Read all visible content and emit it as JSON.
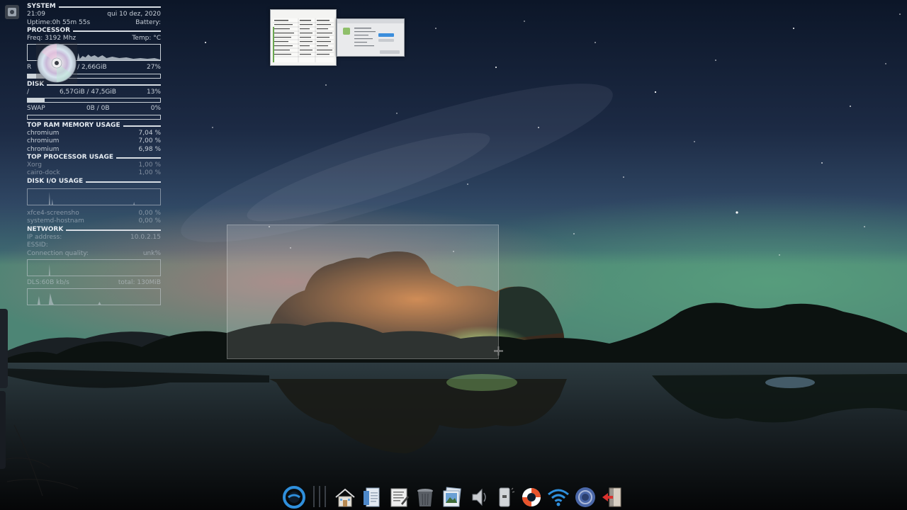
{
  "conky": {
    "system": {
      "header": "SYSTEM",
      "time": "21:09",
      "date": "qui 10 dez, 2020",
      "uptime": "Uptime:0h 55m 55s",
      "battery": "Battery:"
    },
    "processor": {
      "header": "PROCESSOR",
      "freq": "Freq: 3192 Mhz",
      "temp": "Temp: °C"
    },
    "memory": {
      "label": "R",
      "usage": "3 / 2,66GiB",
      "percent": "27%",
      "fill": 0.27
    },
    "disk": {
      "header": "DISK",
      "mount": "/",
      "usage": "6,57GiB / 47,5GiB",
      "percent": "13%",
      "fill": 0.13
    },
    "swap": {
      "label": "SWAP",
      "usage": "0B  /  0B",
      "percent": "0%",
      "fill": 0.0
    },
    "top_ram": {
      "header": "TOP RAM MEMORY USAGE",
      "items": [
        {
          "name": "chromium",
          "value": "7,04 %"
        },
        {
          "name": "chromium",
          "value": "7,00 %"
        },
        {
          "name": "chromium",
          "value": "6,98 %"
        }
      ]
    },
    "top_cpu": {
      "header": "TOP PROCESSOR USAGE",
      "items": [
        {
          "name": "Xorg",
          "value": "1,00 %"
        },
        {
          "name": "cairo-dock",
          "value": "1,00 %"
        }
      ]
    },
    "disk_io": {
      "header": "DISK I/O USAGE",
      "items": [
        {
          "name": "xfce4-screensho",
          "value": "0,00 %"
        },
        {
          "name": "systemd-hostnam",
          "value": "0,00 %"
        }
      ]
    },
    "network": {
      "header": "NETWORK",
      "ip_label": "IP address:",
      "ip": "10.0.2.15",
      "essid": "ESSID:",
      "quality_label": "Connection quality:",
      "quality": "unk%",
      "dl": "DLS:60B  kb/s",
      "total": "total: 130MiB"
    }
  },
  "dock": {
    "items": [
      "start-menu-icon",
      "home-icon",
      "document-viewer-icon",
      "text-editor-icon",
      "trash-icon",
      "image-viewer-icon",
      "volume-icon",
      "usb-drive-icon",
      "help-lifebuoy-icon",
      "wifi-icon",
      "browser-icon",
      "logout-icon"
    ]
  },
  "colors": {
    "conky_text": "#c7cfd8",
    "dock_accent": "#2f8fdc"
  }
}
